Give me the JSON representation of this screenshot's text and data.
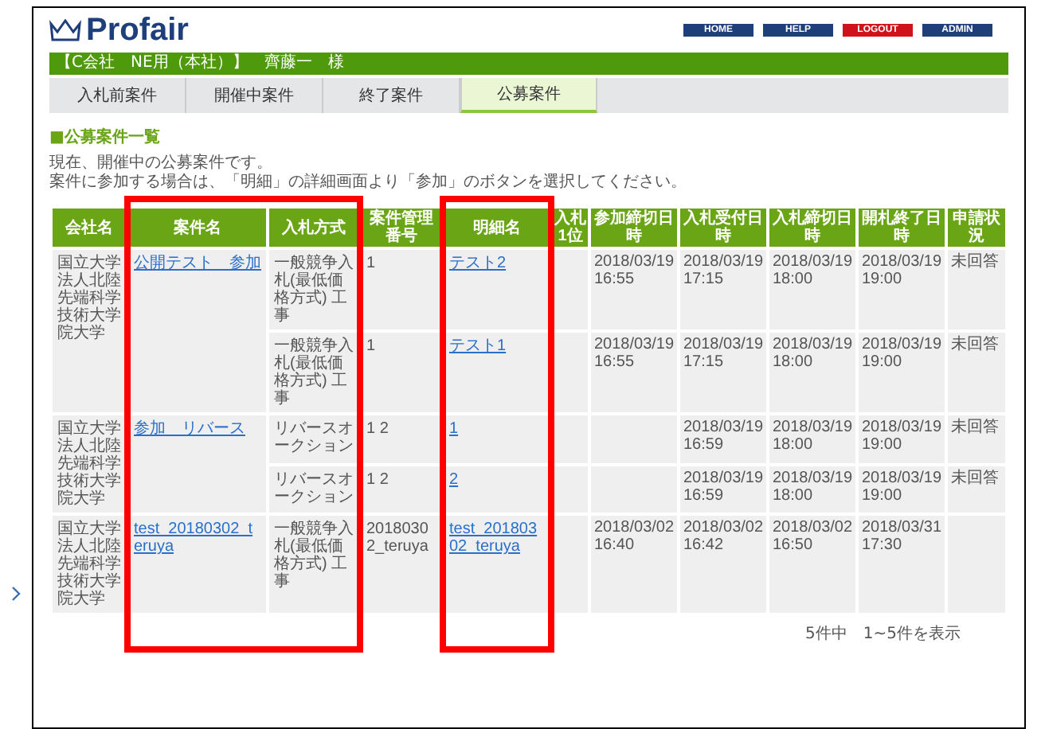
{
  "header": {
    "logo": "Profair",
    "nav_buttons": [
      {
        "label": "HOME",
        "color": "#1f3f7a"
      },
      {
        "label": "HELP",
        "color": "#1f3f7a"
      },
      {
        "label": "LOGOUT",
        "color": "#d0121b"
      },
      {
        "label": "ADMIN",
        "color": "#1f3f7a"
      }
    ]
  },
  "user_bar": "【C会社　NE用（本社）】　齊藤一　様",
  "tabs": [
    {
      "label": "入札前案件",
      "selected": false
    },
    {
      "label": "開催中案件",
      "selected": false
    },
    {
      "label": "終了案件",
      "selected": false
    },
    {
      "label": "公募案件",
      "selected": true
    }
  ],
  "section_title": "■公募案件一覧",
  "description": [
    "現在、開催中の公募案件です。",
    "案件に参加する場合は、「明細」の詳細画面より「参加」のボタンを選択してください。"
  ],
  "table": {
    "columns": [
      "会社名",
      "案件名",
      "入札方式",
      "案件管理番号",
      "明細名",
      "入札1位",
      "参加締切日時",
      "入札受付日時",
      "入札締切日時",
      "開札終了日時",
      "申請状況"
    ],
    "groups": [
      {
        "company": "国立大学法人北陸先端科学技術大学院大学",
        "project": "公開テスト　参加",
        "rows": [
          {
            "method": "一般競争入札(最低価格方式) 工事",
            "number": "1",
            "detail": "テスト2",
            "deadline": "2018/03/19 16:55",
            "reception": "2018/03/19 17:15",
            "close": "2018/03/19 18:00",
            "end": "2018/03/19 19:00",
            "status": "未回答"
          },
          {
            "method": "一般競争入札(最低価格方式) 工事",
            "number": "1",
            "detail": "テスト1",
            "deadline": "2018/03/19 16:55",
            "reception": "2018/03/19 17:15",
            "close": "2018/03/19 18:00",
            "end": "2018/03/19 19:00",
            "status": "未回答"
          }
        ]
      },
      {
        "company": "国立大学法人北陸先端科学技術大学院大学",
        "project": "参加　リバース",
        "rows": [
          {
            "method": "リバースオークション",
            "number": "1 2",
            "detail": "1",
            "reception": "2018/03/19 16:59",
            "close": "2018/03/19 18:00",
            "end": "2018/03/19 19:00",
            "status": "未回答"
          },
          {
            "method": "リバースオークション",
            "number": "1 2",
            "detail": "2",
            "reception": "2018/03/19 16:59",
            "close": "2018/03/19 18:00",
            "end": "2018/03/19 19:00",
            "status": "未回答"
          }
        ]
      },
      {
        "company": "国立大学法人北陸先端科学技術大学院大学",
        "project": "test_20180302_teruya",
        "rows": [
          {
            "method": "一般競争入札(最低価格方式) 工事",
            "number": "20180302_teruya",
            "detail": "test_20180302_teruya",
            "deadline": "2018/03/02 16:40",
            "reception": "2018/03/02 16:42",
            "close": "2018/03/02 16:50",
            "end": "2018/03/31 17:30"
          }
        ]
      }
    ]
  },
  "footer": "5件中　1~5件を表示"
}
